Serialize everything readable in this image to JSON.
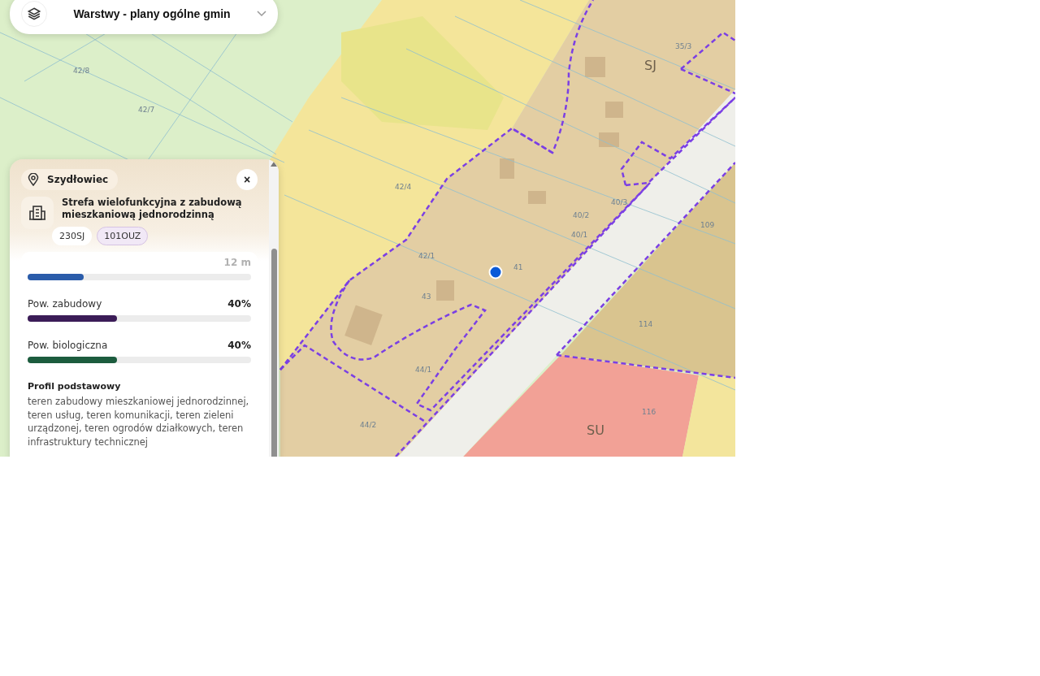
{
  "layers_control": {
    "title": "Warstwy - plany ogólne gmin"
  },
  "map": {
    "zone_labels": [
      {
        "text": "SJ",
        "kind": "zone"
      },
      {
        "text": "SU",
        "kind": "zone"
      }
    ],
    "parcel_labels": [
      {
        "text": "42/8"
      },
      {
        "text": "42/7"
      },
      {
        "text": "42/4"
      },
      {
        "text": "42/1"
      },
      {
        "text": "41"
      },
      {
        "text": "43"
      },
      {
        "text": "44/1"
      },
      {
        "text": "44/2"
      },
      {
        "text": "40/1"
      },
      {
        "text": "40/2"
      },
      {
        "text": "40/3"
      },
      {
        "text": "35/3"
      },
      {
        "text": "109"
      },
      {
        "text": "114"
      },
      {
        "text": "116"
      }
    ]
  },
  "info_panel": {
    "location": "Szydłowiec",
    "close": "×",
    "title": "Strefa wielofunkcyjna z zabudową mieszkaniową jednorodzinną",
    "tags": [
      {
        "label": "230SJ",
        "selected": false
      },
      {
        "label": "101OUZ",
        "selected": true
      }
    ],
    "metrics": [
      {
        "reading": "12 m",
        "level": 0.25,
        "color": "#2a5caa",
        "faded": true
      },
      {
        "label": "Pow. zabudowy",
        "reading": "40%",
        "level": 0.4,
        "color": "#3b1c57",
        "faded": false
      },
      {
        "label": "Pow. biologiczna",
        "reading": "40%",
        "level": 0.4,
        "color": "#1c5c3e",
        "faded": false
      }
    ],
    "profile": {
      "title": "Profil podstawowy",
      "text": "teren zabudowy mieszkaniowej jednorodzinnej, teren usług, teren komunikacji, teren zieleni urządzonej, teren ogrodów działkowych, teren infrastruktury technicznej"
    }
  }
}
